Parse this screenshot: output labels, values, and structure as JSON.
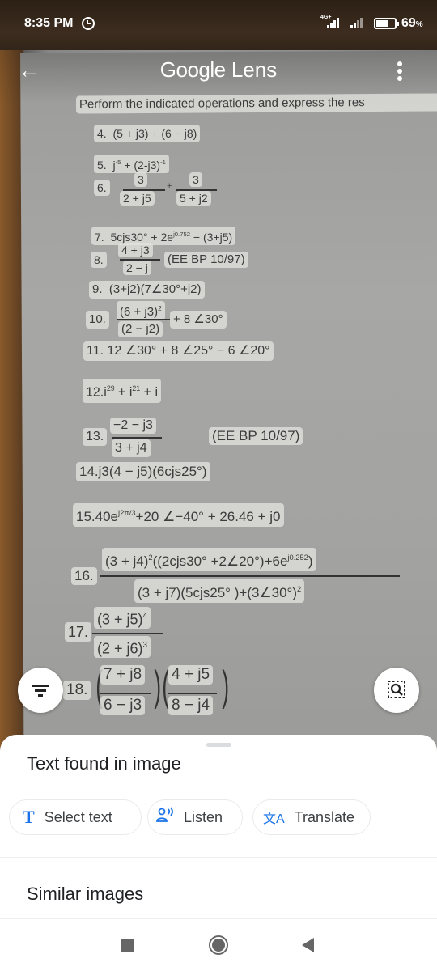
{
  "status_bar": {
    "time": "8:35 PM",
    "alarm_icon": "alarm-clock-icon",
    "network_label": "4G+",
    "battery_percent": 69,
    "battery_text": "69",
    "battery_unit": "%"
  },
  "app_bar": {
    "title_brand": "Google",
    "title_product": "Lens",
    "back_icon": "arrow-left-icon",
    "more_icon": "more-vertical-icon"
  },
  "image_text": {
    "instructions": "Perform the indicated operations and express the res",
    "problems": [
      {
        "num": "4.",
        "expr": "(5 + j3) + (6 − j8)"
      },
      {
        "num": "5.",
        "expr_base": "j",
        "expr_exp1": "-5",
        "expr_mid": " + (2-j3)",
        "expr_exp2": "-1"
      },
      {
        "num": "6.",
        "num1": "3",
        "den1": "2 + j5",
        "op": "+",
        "num2": "3",
        "den2": "5 + j2"
      },
      {
        "num": "7.",
        "expr_a": "5cjs30° + 2e",
        "expr_exp": "j0.752",
        "expr_b": " − (3+j5)"
      },
      {
        "num": "8.",
        "numer": "4 + j3",
        "denom": "2 − j",
        "note": "(EE BP 10/97)"
      },
      {
        "num": "9.",
        "expr": "(3+j2)(7∠30°+j2)"
      },
      {
        "num": "10.",
        "numer": "(6 + j3)",
        "numer_exp": "2",
        "denom": "(2 − j2)",
        "tail": "+ 8 ∠30°"
      },
      {
        "num": "11.",
        "expr": "12 ∠30° + 8 ∠25° − 6 ∠20°"
      },
      {
        "num": "12.",
        "expr_a": "i",
        "exp_a": "29",
        "expr_b": " + i",
        "exp_b": "21",
        "expr_c": " + i"
      },
      {
        "num": "13.",
        "numer": "−2 − j3",
        "denom": "3 + j4",
        "note": "(EE BP 10/97)"
      },
      {
        "num": "14.",
        "expr": "j3(4 − j5)(6cjs25°)"
      },
      {
        "num": "15.",
        "expr_a": "40e",
        "expr_exp": "j2π/3",
        "expr_b": "+20 ∠−40° + 26.46 + j0"
      },
      {
        "num": "16.",
        "numer_a": "(3 + j4)",
        "numer_exp": "2",
        "numer_b": "((2cjs30° +2∠20°)+6e",
        "numer_exp2": "j0.252",
        "numer_c": ")",
        "denom_a": "(3 + j7)(5cjs25° )+(3∠30°)",
        "denom_exp": "2"
      },
      {
        "num": "17.",
        "numer": "(3 + j5)",
        "numer_exp": "4",
        "denom": "(2 + j6)",
        "denom_exp": "3"
      },
      {
        "num": "18.",
        "numer1": "7 + j8",
        "denom1": "6 − j3",
        "numer2": "4 + j5",
        "denom2": "8 − j4"
      }
    ]
  },
  "floating": {
    "filter_icon": "filter-icon",
    "lens_search_icon": "region-search-icon"
  },
  "sheet": {
    "heading": "Text found in image",
    "chips": [
      {
        "label": "Select text",
        "icon": "text-select-icon",
        "glyph": "T"
      },
      {
        "label": "Listen",
        "icon": "listen-icon",
        "glyph": "🗣"
      },
      {
        "label": "Translate",
        "icon": "translate-icon",
        "glyph": "文A"
      }
    ],
    "similar_heading": "Similar images"
  },
  "nav_bar": {
    "recents_icon": "recents-square-icon",
    "home_icon": "home-circle-icon",
    "back_icon": "back-triangle-icon"
  }
}
